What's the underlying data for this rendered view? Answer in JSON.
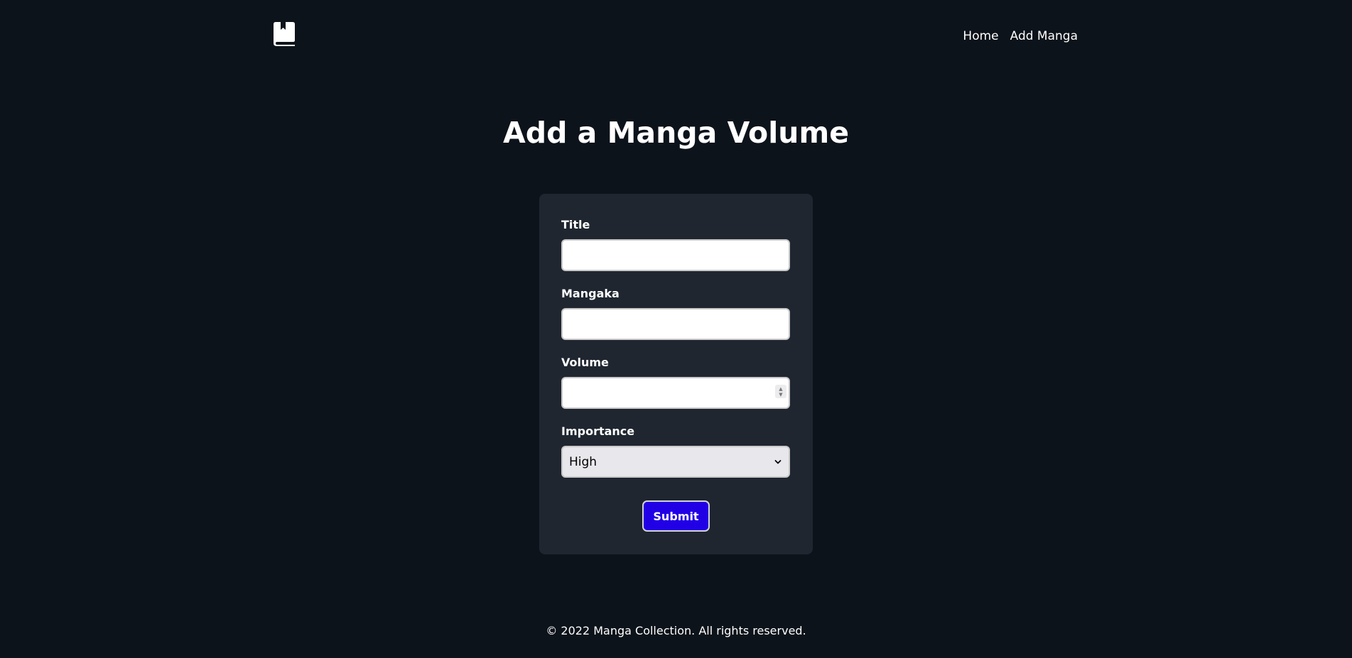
{
  "header": {
    "logo_icon": "book-bookmark-icon",
    "nav": [
      {
        "label": "Home"
      },
      {
        "label": "Add Manga"
      }
    ]
  },
  "main": {
    "title": "Add a Manga Volume",
    "form": {
      "title_label": "Title",
      "title_value": "",
      "mangaka_label": "Mangaka",
      "mangaka_value": "",
      "volume_label": "Volume",
      "volume_value": "",
      "importance_label": "Importance",
      "importance_value": "High",
      "submit_label": "Submit"
    }
  },
  "footer": {
    "text": "© 2022 Manga Collection. All rights reserved."
  },
  "colors": {
    "background": "#0d131b",
    "card": "#1f2630",
    "accent": "#2200e6"
  }
}
